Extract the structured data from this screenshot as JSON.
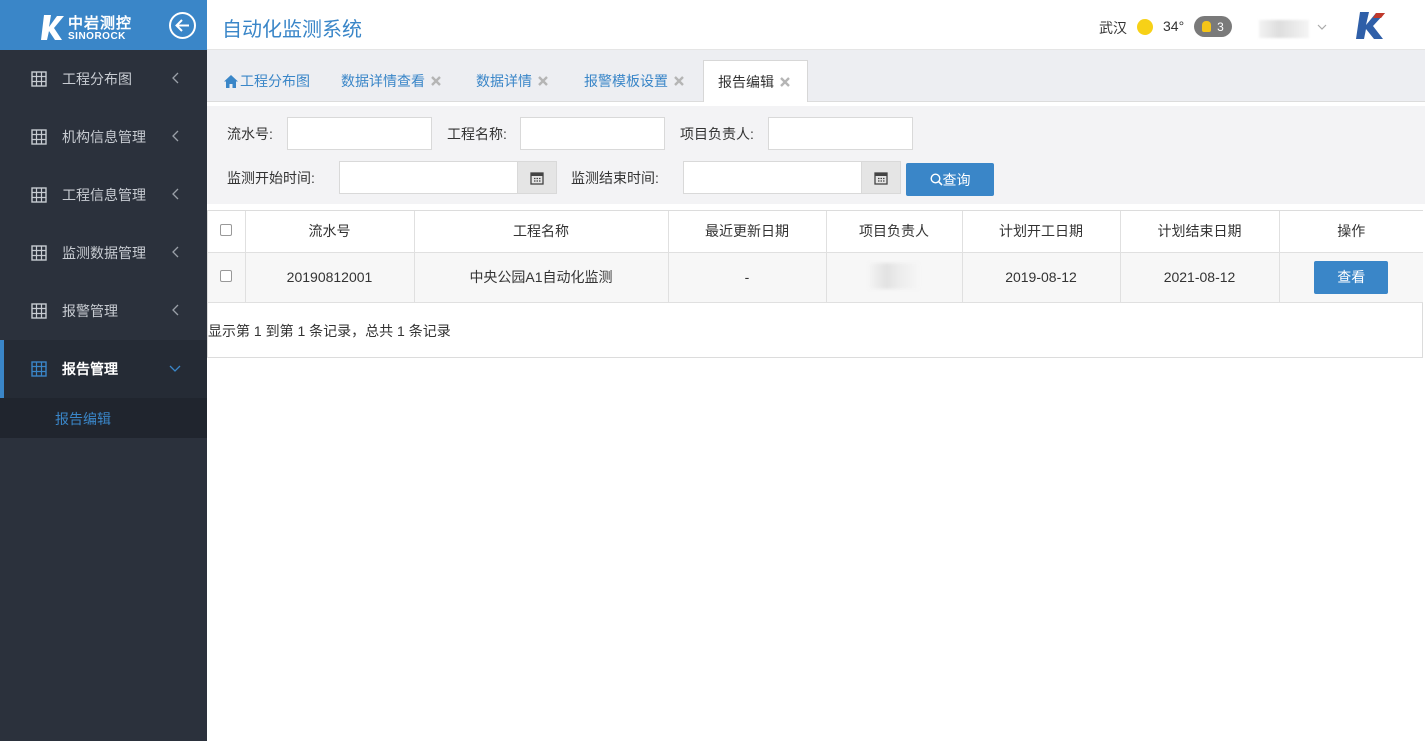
{
  "app": {
    "title": "自动化监测系统"
  },
  "logo": {
    "cn": "中岩测控",
    "en": "SINOROCK"
  },
  "header": {
    "city": "武汉",
    "temperature": "34°",
    "alert_count": "3"
  },
  "sidebar": {
    "items": [
      {
        "label": "工程分布图",
        "expanded": false
      },
      {
        "label": "机构信息管理",
        "expanded": false
      },
      {
        "label": "工程信息管理",
        "expanded": false
      },
      {
        "label": "监测数据管理",
        "expanded": false
      },
      {
        "label": "报警管理",
        "expanded": false
      },
      {
        "label": "报告管理",
        "expanded": true
      }
    ],
    "sub_items": [
      {
        "label": "报告编辑"
      }
    ]
  },
  "tabs": [
    {
      "label": "工程分布图",
      "icon": "home-icon",
      "closable": false
    },
    {
      "label": "数据详情查看",
      "closable": true
    },
    {
      "label": "数据详情",
      "closable": true
    },
    {
      "label": "报警模板设置",
      "closable": true
    },
    {
      "label": "报告编辑",
      "closable": true,
      "active": true
    }
  ],
  "search": {
    "serial_label": "流水号:",
    "project_label": "工程名称:",
    "owner_label": "项目负责人:",
    "start_label": "监测开始时间:",
    "end_label": "监测结束时间:",
    "query_label": "查询"
  },
  "table": {
    "headers": [
      "流水号",
      "工程名称",
      "最近更新日期",
      "项目负责人",
      "计划开工日期",
      "计划结束日期",
      "操作"
    ],
    "rows": [
      {
        "serial": "20190812001",
        "name": "中央公园A1自动化监测",
        "updated": "-",
        "start": "2019-08-12",
        "end": "2021-08-12",
        "action": "查看"
      }
    ],
    "pagination": "显示第 1 到第 1 条记录，总共 1 条记录"
  },
  "colors": {
    "accent": "#3a86c8",
    "sidebar_bg": "#2b313c",
    "sun": "#f7d117"
  }
}
